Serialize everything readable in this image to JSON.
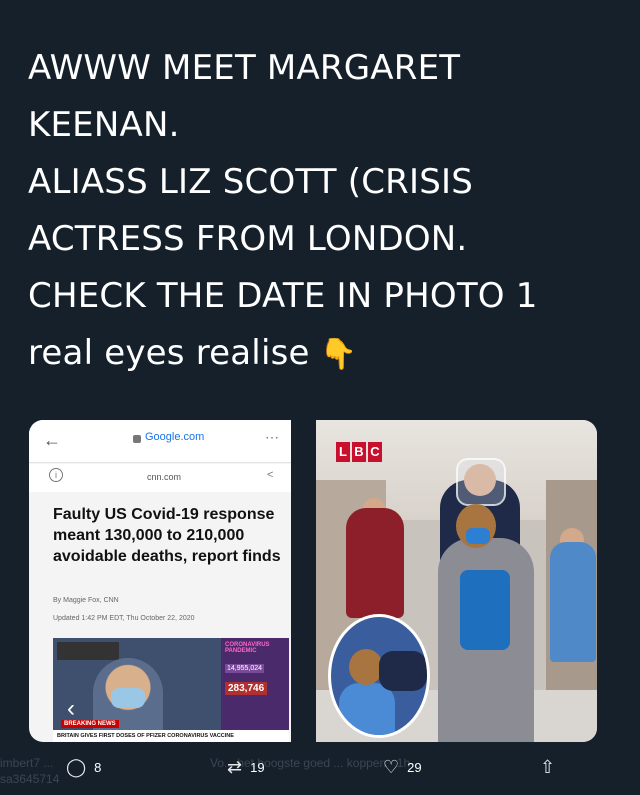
{
  "tweet": {
    "lines": [
      "AWWW MEET MARGARET",
      "KEENAN.",
      "ALIASS LIZ SCOTT (CRISIS",
      "ACTRESS FROM LONDON.",
      "CHECK THE DATE IN PHOTO 1",
      "real eyes realise"
    ],
    "emoji": "👇"
  },
  "photo1": {
    "domain": "Google.com",
    "url": "cnn.com",
    "headline": "Faulty US Covid-19 response meant 130,000 to 210,000 avoidable deaths, report finds",
    "byline": "By Maggie Fox, CNN",
    "updated": "Updated 1:42 PM EDT, Thu October 22, 2020",
    "video": {
      "tally_header": "CORONAVIRUS PANDEMIC",
      "count_a": "14,955,024",
      "count_b": "283,746",
      "breaking": "BREAKING NEWS",
      "chyron": "BRITAIN GIVES FIRST DOSES OF PFIZER CORONAVIRUS VACCINE"
    }
  },
  "photo2": {
    "logo_letters": [
      "L",
      "B",
      "C"
    ]
  },
  "actions": {
    "reply_count": "8",
    "retweet_count": "19",
    "like_count": "29"
  },
  "background_ghost": {
    "left": "imbert7 ...",
    "left2": "sa3645714",
    "middle": "Vo... het hoogste goed ... koppen · 1h"
  },
  "colors": {
    "background": "#15202b",
    "text": "#ffffff",
    "cnn_red": "#c00000",
    "lbc_red": "#c8102e"
  }
}
